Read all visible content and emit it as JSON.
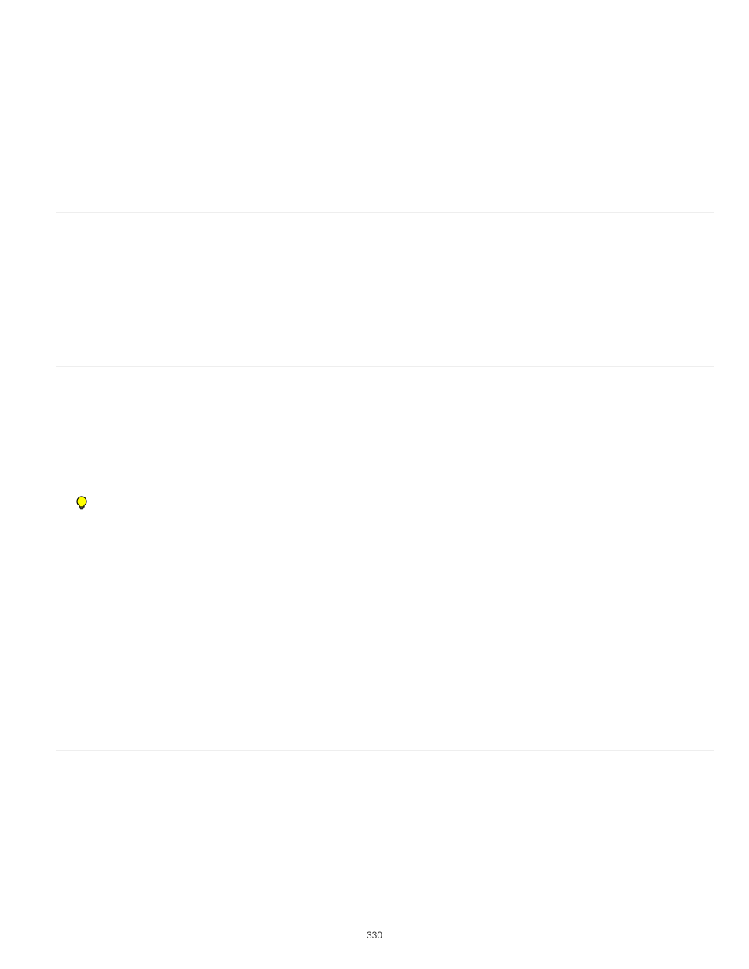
{
  "page_number": "330",
  "icon_name": "lightbulb-icon"
}
